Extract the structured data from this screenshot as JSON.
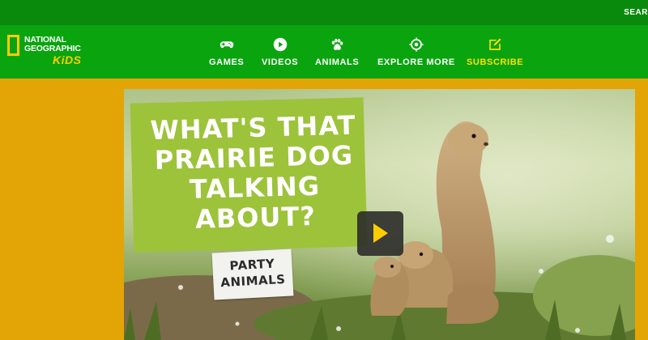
{
  "topbar": {
    "search_label": "SEAR"
  },
  "logo": {
    "line1": "NATIONAL",
    "line2": "GEOGRAPHIC",
    "kids": "KiDS",
    "accent": "#ffcc00"
  },
  "nav": {
    "items": [
      {
        "label": "GAMES",
        "icon": "gamepad-icon"
      },
      {
        "label": "VIDEOS",
        "icon": "play-circle-icon"
      },
      {
        "label": "ANIMALS",
        "icon": "paw-icon"
      },
      {
        "label": "EXPLORE MORE",
        "icon": "target-icon"
      },
      {
        "label": "SUBSCRIBE",
        "icon": "edit-icon"
      }
    ],
    "label_color": "#ffffff",
    "subscribe_color": "#ffe000"
  },
  "hero": {
    "title_lines": [
      "WHAT'S THAT",
      "PRAIRIE DOG",
      "TALKING",
      "ABOUT?"
    ],
    "tag_lines": [
      "PARTY",
      "ANIMALS"
    ],
    "play_icon": "play-icon",
    "panel_color": "#9cc33a"
  },
  "colors": {
    "page_bg": "#e3a505",
    "topbar_bg": "#0a8a0c",
    "nav_bg": "#0aa40f"
  }
}
